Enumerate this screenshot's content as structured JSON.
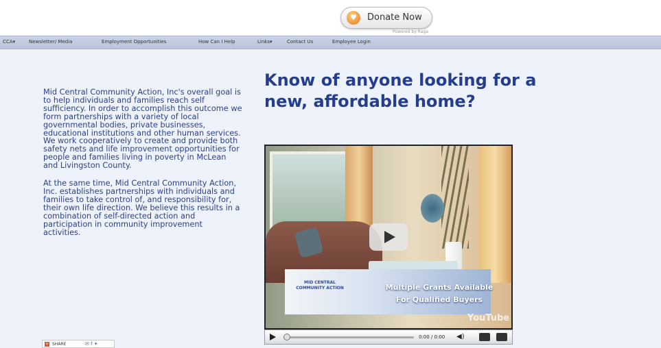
{
  "donate": {
    "label": "Donate Now",
    "icon": "donate-icon",
    "powered_by": "Powered by Raga"
  },
  "nav": {
    "items": [
      "CCA▾",
      "Newsletter/ Media",
      "Employment Opportunities",
      "How Can I Help",
      "Links▾",
      "Contact Us",
      "Employee Login"
    ]
  },
  "intro": {
    "paragraph1": "Mid Central Community Action, Inc's overall goal is to help individuals and families reach self sufficiency. In order to accomplish this outcome we form partnerships with a variety of local governmental bodies, private businesses, educational institutions and other human services. We work cooperatively to create and provide both safety nets and life improvement opportunities for people and families living in poverty in McLean and Livingston County.",
    "paragraph2": "At the same time, Mid Central Community Action, Inc. establishes partnerships with individuals and families to take control of, and responsibility for, their own life direction. We believe this results in a combination of self-directed action and participation in community improvement activities."
  },
  "share": {
    "label": "SHARE",
    "icon": "share-icon"
  },
  "headline": "Know of anyone looking for a new, affordable home?",
  "video": {
    "banner_logo": "MID CENTRAL COMMUNITY ACTION",
    "banner_line1": "Multiple Grants Available",
    "banner_line2": "For Qualified Buyers",
    "watermark": "YouTube",
    "time": "0:00 / 0:00",
    "progress": 0
  },
  "colors": {
    "page_bg": "#eef2fb",
    "text": "#2a3f88",
    "headline": "#243d8d",
    "nav_bg": "#c2cde2"
  }
}
